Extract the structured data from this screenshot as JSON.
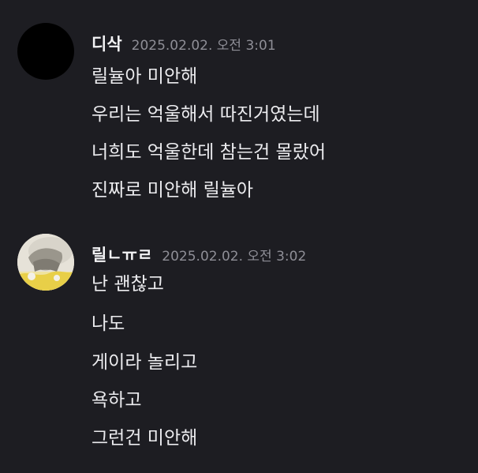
{
  "messages": [
    {
      "username": "디삭",
      "timestamp": "2025.02.02. 오전 3:01",
      "avatar": "black-circle-avatar",
      "lines": [
        "릴뉼아 미안해",
        "우리는 억울해서 따진거였는데",
        "너희도 억울한데 참는건 몰랐어",
        "진짜로 미안해 릴뉼아"
      ]
    },
    {
      "username": "릴ㄴㅠㄹ",
      "timestamp": "2025.02.02. 오전 3:02",
      "avatar": "photo-avatar",
      "lines": [
        "난 괜찮고",
        "나도",
        "게이라 놀리고",
        "욕하고",
        "그런건 미안해"
      ]
    }
  ]
}
